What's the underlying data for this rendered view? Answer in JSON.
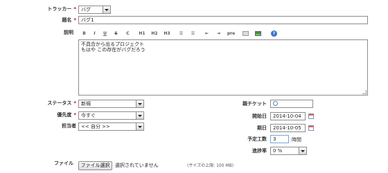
{
  "form": {
    "tracker": {
      "label": "トラッカー",
      "required": "*",
      "value": "バグ"
    },
    "subject": {
      "label": "題名",
      "required": "*",
      "value": "バグ1"
    },
    "description": {
      "label": "説明",
      "toolbar": [
        "B",
        "I",
        "U",
        "S",
        "C",
        "H1",
        "H2",
        "H3",
        "☰",
        "☰",
        "⇤",
        "⇥",
        "pre",
        "",
        "",
        "?"
      ],
      "text": "不具合から出るプロジェクト\nもはや この存在がバグだろう"
    },
    "status": {
      "label": "ステータス",
      "required": "*",
      "value": "新規"
    },
    "priority": {
      "label": "優先度",
      "required": "*",
      "value": "今すぐ"
    },
    "assignee": {
      "label": "担当者",
      "value": "<< 自分 >>"
    },
    "parent_ticket": {
      "label": "親チケット",
      "value": ""
    },
    "start_date": {
      "label": "開始日",
      "value": "2014-10-04"
    },
    "due_date": {
      "label": "期日",
      "value": "2014-10-05"
    },
    "estimated_time": {
      "label": "予定工数",
      "value": "3",
      "unit": "時間"
    },
    "done_ratio": {
      "label": "進捗率",
      "value": "0 %"
    },
    "file": {
      "label": "ファイル",
      "button": "ファイル選択",
      "status": "選択されていません",
      "max_size": "(サイズの上限: 100 MB)"
    }
  },
  "colors": {
    "required": "#cc0000",
    "border": "#8c8c8c"
  }
}
